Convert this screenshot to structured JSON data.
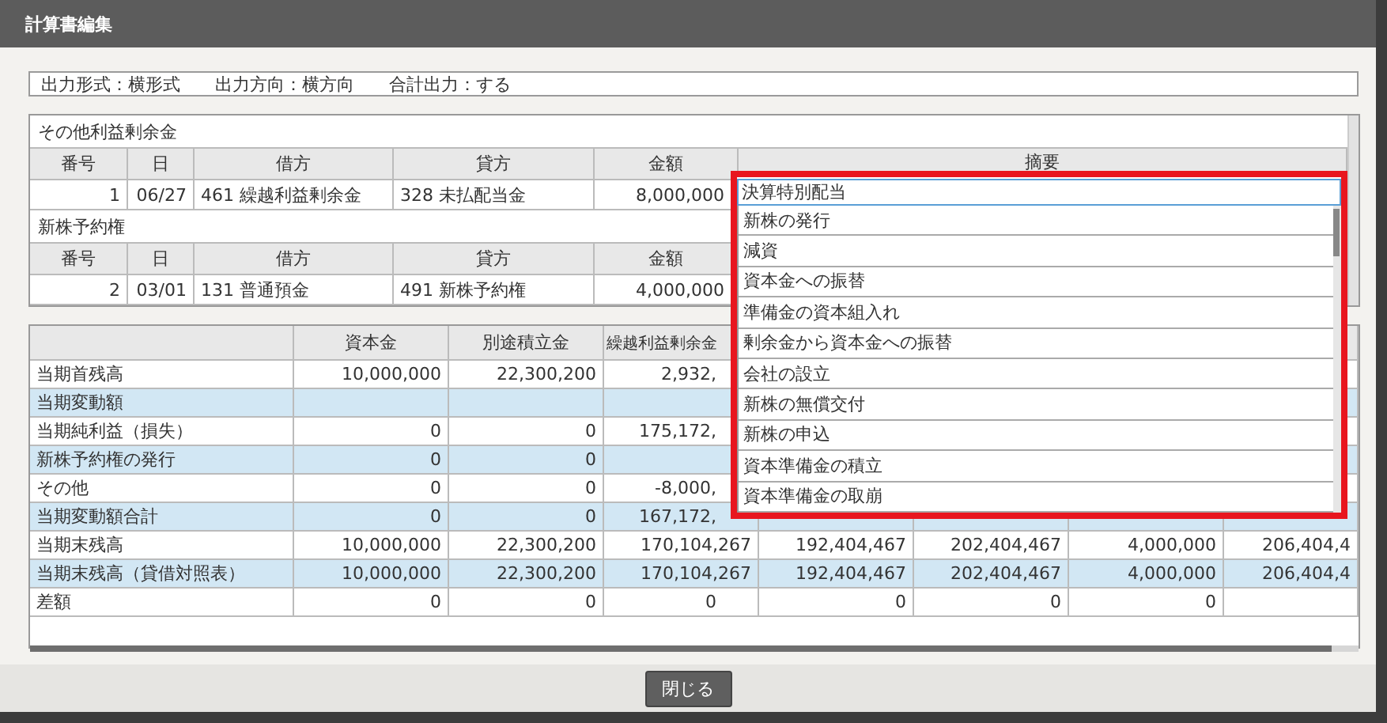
{
  "dialog": {
    "title": "計算書編集"
  },
  "output_settings": [
    "出力形式：横形式",
    "出力方向：横方向",
    "合計出力：する"
  ],
  "journal_groups": [
    {
      "title": "その他利益剰余金",
      "columns": [
        "番号",
        "日",
        "借方",
        "貸方",
        "金額",
        "摘要"
      ],
      "rows": [
        {
          "number": "1",
          "date": "06/27",
          "debit": "461 繰越利益剰余金",
          "credit": "328 未払配当金",
          "amount": "8,000,000"
        }
      ]
    },
    {
      "title": "新株予約権",
      "columns": [
        "番号",
        "日",
        "借方",
        "貸方",
        "金額"
      ],
      "rows": [
        {
          "number": "2",
          "date": "03/01",
          "debit": "131 普通預金",
          "credit": "491 新株予約権",
          "amount": "4,000,000"
        }
      ]
    }
  ],
  "summary_dropdown": {
    "value": "決算特別配当",
    "options": [
      "新株の発行",
      "減資",
      "資本金への振替",
      "準備金の資本組入れ",
      "剰余金から資本金への振替",
      "会社の設立",
      "新株の無償交付",
      "新株の申込",
      "資本準備金の積立",
      "資本準備金の取崩"
    ]
  },
  "statement_table": {
    "columns": [
      "資本金",
      "別途積立金",
      "繰越利益剰余金"
    ],
    "rows": [
      {
        "label": "当期首残高",
        "highlighted": false,
        "cells": [
          "10,000,000",
          "22,300,200",
          "2,932,"
        ]
      },
      {
        "label": "当期変動額",
        "highlighted": true,
        "cells": []
      },
      {
        "label": "当期純利益（損失）",
        "highlighted": false,
        "cells": [
          "0",
          "0",
          "175,172,"
        ]
      },
      {
        "label": "新株予約権の発行",
        "highlighted": true,
        "cells": [
          "0",
          "0"
        ]
      },
      {
        "label": "その他",
        "highlighted": false,
        "cells": [
          "0",
          "0",
          "-8,000,"
        ]
      },
      {
        "label": "当期変動額合計",
        "highlighted": true,
        "cells": [
          "0",
          "0",
          "167,172,"
        ]
      },
      {
        "label": "当期末残高",
        "highlighted": false,
        "cells": [
          "10,000,000",
          "22,300,200",
          "170,104,267",
          "192,404,467",
          "202,404,467",
          "4,000,000",
          "206,404,4"
        ]
      },
      {
        "label": "当期末残高（貸借対照表）",
        "highlighted": true,
        "cells": [
          "10,000,000",
          "22,300,200",
          "170,104,267",
          "192,404,467",
          "202,404,467",
          "4,000,000",
          "206,404,4"
        ]
      },
      {
        "label": "差額",
        "highlighted": false,
        "cells": [
          "0",
          "0",
          "0",
          "0",
          "0",
          "0"
        ]
      }
    ]
  },
  "footer": {
    "close_button": "閉じる"
  }
}
